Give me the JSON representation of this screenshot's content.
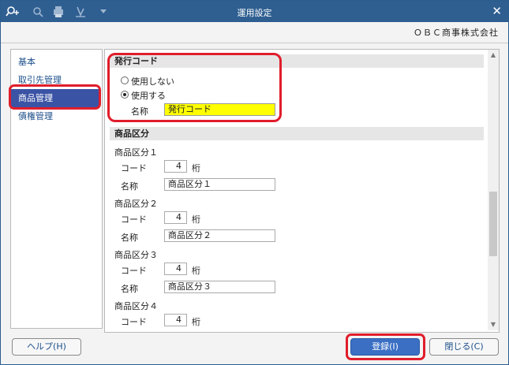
{
  "window": {
    "title": "運用設定",
    "close_glyph": "✕"
  },
  "company": "ＯＢＣ商事株式会社",
  "sidebar": {
    "items": [
      {
        "label": "基本"
      },
      {
        "label": "取引先管理"
      },
      {
        "label": "商品管理"
      },
      {
        "label": "債権管理"
      }
    ]
  },
  "issue_code": {
    "heading": "発行コード",
    "option_no": "使用しない",
    "option_yes": "使用する",
    "name_label": "名称",
    "name_value": "発行コード"
  },
  "product_category": {
    "heading": "商品区分",
    "groups": [
      {
        "title": "商品区分１",
        "code_label": "コード",
        "digits": "4",
        "unit": "桁",
        "name_label": "名称",
        "name_value": "商品区分１"
      },
      {
        "title": "商品区分２",
        "code_label": "コード",
        "digits": "4",
        "unit": "桁",
        "name_label": "名称",
        "name_value": "商品区分２"
      },
      {
        "title": "商品区分３",
        "code_label": "コード",
        "digits": "4",
        "unit": "桁",
        "name_label": "名称",
        "name_value": "商品区分３"
      },
      {
        "title": "商品区分４",
        "code_label": "コード",
        "digits": "4",
        "unit": "桁"
      }
    ]
  },
  "buttons": {
    "help": "ヘルプ(H)",
    "register": "登録(I)",
    "close": "閉じる(C)"
  }
}
